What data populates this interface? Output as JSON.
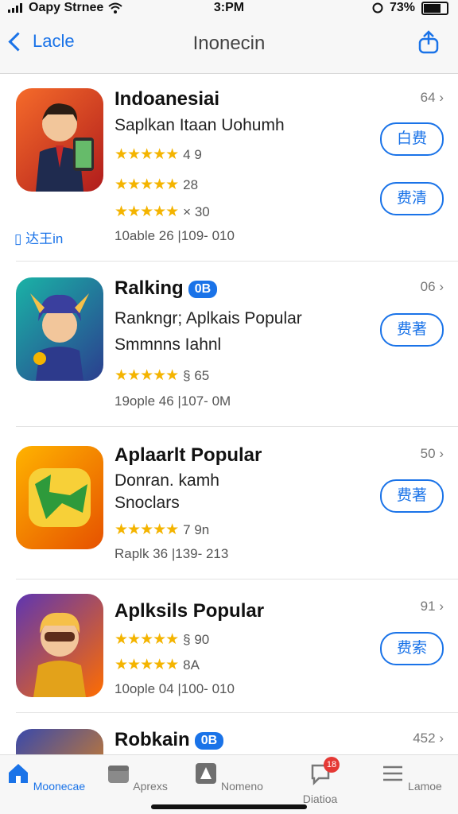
{
  "status": {
    "carrier": "Oapy Strnee",
    "time": "3:PM",
    "battery": "73%"
  },
  "nav": {
    "back_label": "Lacle",
    "title": "Inonecin"
  },
  "apps": [
    {
      "name": "Indoanesiai",
      "subtitle": "Saplkan Itaan Uohumh",
      "subtitle2": "",
      "ratings": [
        "4 9",
        "28",
        "× 30"
      ],
      "meta": "10able 26 |109- 010",
      "rank": "64",
      "buttons": [
        "白费",
        "费清"
      ],
      "side_link": "达王in",
      "badge": ""
    },
    {
      "name": "Ralking",
      "subtitle": "Rankngr; Aplkais Popular",
      "subtitle2": "Smmnns Iahnl",
      "ratings": [
        "§ 65"
      ],
      "meta": "19ople 46 |107- 0M",
      "rank": "06",
      "buttons": [
        "费著"
      ],
      "side_link": "",
      "badge": "0B"
    },
    {
      "name": "Aplaarlt Popular",
      "subtitle": "Donran. kamh",
      "subtitle2": "Snoclars",
      "ratings": [
        "7 9n"
      ],
      "meta": "Raplk 36 |139- 213",
      "rank": "50",
      "buttons": [
        "费著"
      ],
      "side_link": "",
      "badge": ""
    },
    {
      "name": "Aplksils Popular",
      "subtitle": "",
      "subtitle2": "",
      "ratings": [
        "§ 90",
        "8A"
      ],
      "meta": "10ople 04 |100- 010",
      "rank": "91",
      "buttons": [
        "费索"
      ],
      "side_link": "",
      "badge": ""
    },
    {
      "name": "Robkain",
      "subtitle": "",
      "subtitle2": "",
      "ratings": [],
      "meta": "",
      "rank": "452",
      "buttons": [],
      "side_link": "",
      "badge": "0B"
    }
  ],
  "tabs": [
    {
      "label": "Moonecae",
      "icon": "home-icon"
    },
    {
      "label": "Aprexs",
      "icon": "apps-icon"
    },
    {
      "label": "Nomeno",
      "icon": "games-icon"
    },
    {
      "label": "Diatioa",
      "icon": "updates-icon",
      "badge": "18"
    },
    {
      "label": "Lamoe",
      "icon": "menu-icon"
    }
  ],
  "colors": {
    "accent": "#1a73e8",
    "star": "#f4b400",
    "badge": "#e53935"
  }
}
